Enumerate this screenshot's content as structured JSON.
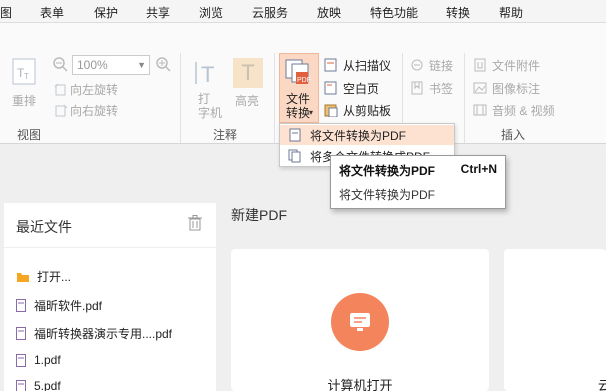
{
  "menu": [
    "图",
    "表单",
    "保护",
    "共享",
    "浏览",
    "云服务",
    "放映",
    "特色功能",
    "转换",
    "帮助"
  ],
  "ribbon": {
    "view": {
      "reflow_label": "重排",
      "zoom_value": "100%",
      "rotate_left": "向左旋转",
      "rotate_right": "向右旋转",
      "group_label": "视图"
    },
    "annotate": {
      "typewriter": "打\n字机",
      "highlight": "高亮",
      "group_label": "注释"
    },
    "convert": {
      "file_convert": "文件\n转换",
      "from_scanner": "从扫描仪",
      "blank_page": "空白页",
      "from_clipboard": "从剪贴板"
    },
    "links": {
      "link": "链接",
      "bookmark": "书签"
    },
    "insert": {
      "attachment": "文件附件",
      "image_annot": "图像标注",
      "audio_video": "音频 & 视频",
      "group_label": "插入"
    }
  },
  "dropdown": {
    "items": [
      "将文件转换为PDF",
      "将多个文件转换成PDF"
    ]
  },
  "tooltip": {
    "title": "将文件转换为PDF",
    "shortcut": "Ctrl+N",
    "description": "将文件转换为PDF"
  },
  "recent": {
    "title": "最近文件",
    "open_label": "打开...",
    "files": [
      "福昕软件.pdf",
      "福昕转换器演示专用....pdf",
      "1.pdf",
      "5.pdf"
    ]
  },
  "new_pdf": {
    "title": "新建PDF",
    "cards": [
      "计算机打开",
      "云"
    ]
  },
  "colors": {
    "accent": "#f3845c",
    "highlight": "#fde1d1"
  }
}
